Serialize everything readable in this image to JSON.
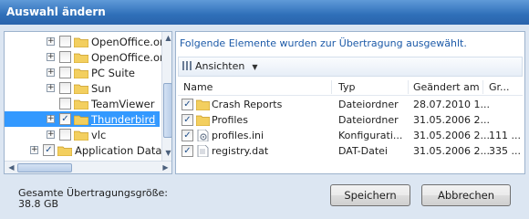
{
  "window": {
    "title": "Auswahl ändern"
  },
  "tree": {
    "items": [
      {
        "label": "OpenOffice.or",
        "checked": false,
        "expandable": true,
        "selected": false
      },
      {
        "label": "OpenOffice.or",
        "checked": false,
        "expandable": true,
        "selected": false
      },
      {
        "label": "PC Suite",
        "checked": false,
        "expandable": true,
        "selected": false
      },
      {
        "label": "Sun",
        "checked": false,
        "expandable": true,
        "selected": false
      },
      {
        "label": "TeamViewer",
        "checked": false,
        "expandable": false,
        "selected": false
      },
      {
        "label": "Thunderbird",
        "checked": true,
        "expandable": true,
        "selected": true
      },
      {
        "label": "vlc",
        "checked": false,
        "expandable": true,
        "selected": false
      },
      {
        "label": "Application Data",
        "checked": true,
        "expandable": true,
        "selected": false
      }
    ]
  },
  "panel": {
    "info_text": "Folgende Elemente wurden zur Übertragung ausgewählt.",
    "views_label": "Ansichten",
    "columns": {
      "name": "Name",
      "type": "Typ",
      "modified": "Geändert am",
      "size": "Gr..."
    },
    "files": [
      {
        "name": "Crash Reports",
        "type": "Dateiordner",
        "modified": "28.07.2010 1...",
        "size": "",
        "icon": "folder-icon"
      },
      {
        "name": "Profiles",
        "type": "Dateiordner",
        "modified": "31.05.2006 2...",
        "size": "",
        "icon": "folder-icon"
      },
      {
        "name": "profiles.ini",
        "type": "Konfigurati...",
        "modified": "31.05.2006 2...",
        "size": "111 ...",
        "icon": "ini-file-icon"
      },
      {
        "name": "registry.dat",
        "type": "DAT-Datei",
        "modified": "31.05.2006 2...",
        "size": "335 ...",
        "icon": "dat-file-icon"
      }
    ]
  },
  "footer": {
    "total_label": "Gesamte Übertragungsgröße:",
    "total_value": "38.8 GB",
    "save_label": "Speichern",
    "cancel_label": "Abbrechen"
  }
}
